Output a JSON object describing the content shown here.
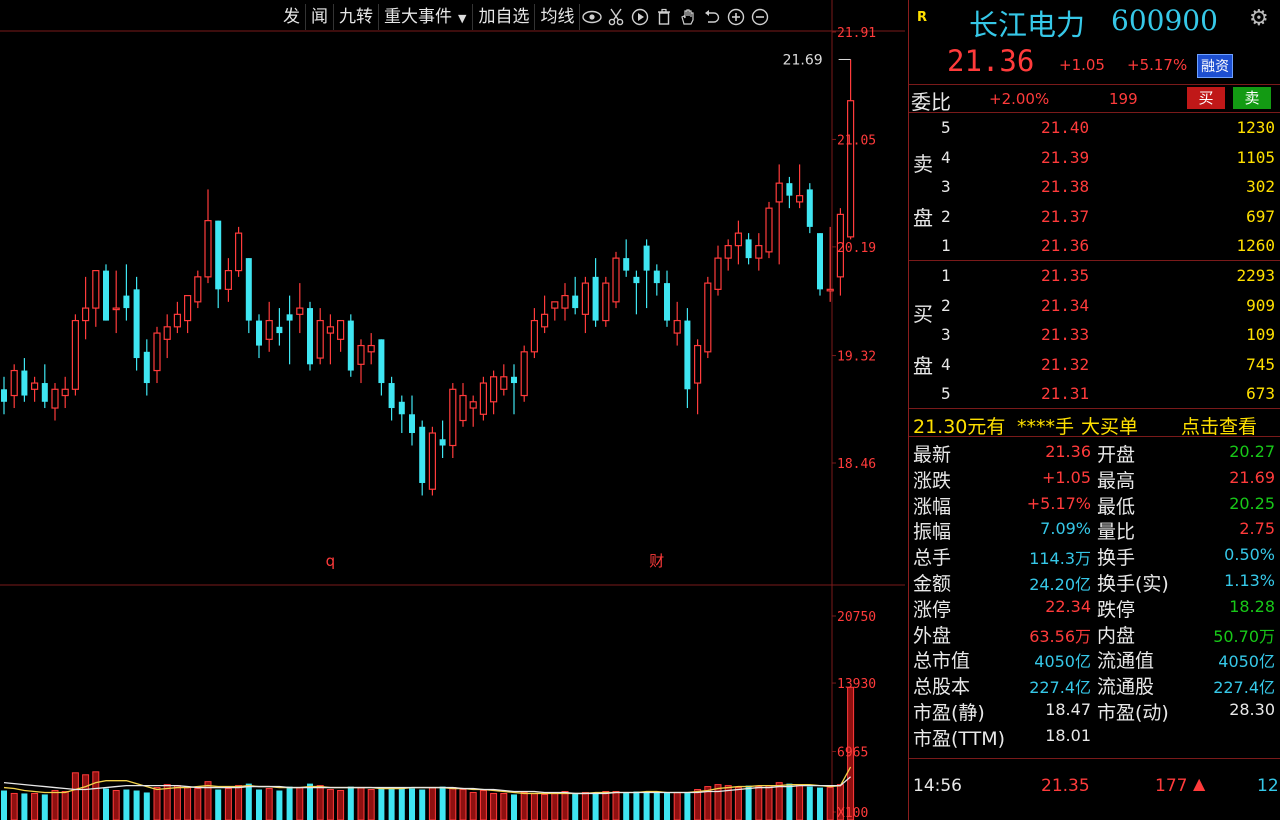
{
  "toolbar": {
    "buttons": [
      "发",
      "闻",
      "九转",
      "重大事件",
      "加自选",
      "均线"
    ],
    "icons": [
      "eye-icon",
      "scissors-icon",
      "play-icon",
      "trash-icon",
      "hand-icon",
      "undo-icon",
      "zoom-in-icon",
      "zoom-out-icon"
    ]
  },
  "main_chart": {
    "y_ticks": [
      "21.91",
      "21.05",
      "20.19",
      "19.32",
      "18.46"
    ],
    "high_marker": "21.69",
    "event_markers": [
      "q",
      "财"
    ]
  },
  "volume_chart": {
    "y_ticks": [
      "20750",
      "13930",
      "6965",
      "X100"
    ]
  },
  "colors": {
    "up": "#ff3b3b",
    "down": "#3fe6f2",
    "grid": "#7a1a1a",
    "ma_yellow": "#f2d24a",
    "ma_white": "#e8e8e8"
  },
  "stock": {
    "badge": "R",
    "name": "长江电力",
    "code": "600900",
    "price": "21.36",
    "change": "+1.05",
    "change_pct": "+5.17%",
    "tag": "融资"
  },
  "weibi": {
    "label": "委比",
    "pct": "+2.00%",
    "diff": "199",
    "buy_btn": "买",
    "sell_btn": "卖"
  },
  "order_book": {
    "sell_label": [
      "卖",
      "盘"
    ],
    "buy_label": [
      "买",
      "盘"
    ],
    "sells": [
      {
        "level": "5",
        "price": "21.40",
        "vol": "1230"
      },
      {
        "level": "4",
        "price": "21.39",
        "vol": "1105"
      },
      {
        "level": "3",
        "price": "21.38",
        "vol": "302"
      },
      {
        "level": "2",
        "price": "21.37",
        "vol": "697"
      },
      {
        "level": "1",
        "price": "21.36",
        "vol": "1260"
      }
    ],
    "buys": [
      {
        "level": "1",
        "price": "21.35",
        "vol": "2293"
      },
      {
        "level": "2",
        "price": "21.34",
        "vol": "909"
      },
      {
        "level": "3",
        "price": "21.33",
        "vol": "109"
      },
      {
        "level": "4",
        "price": "21.32",
        "vol": "745"
      },
      {
        "level": "5",
        "price": "21.31",
        "vol": "673"
      }
    ]
  },
  "big_order": {
    "price": "21.30元有",
    "stars": "****手",
    "text": "大买单",
    "link": "点击查看"
  },
  "stats": [
    {
      "l1": "最新",
      "v1": "21.36",
      "c1": "r",
      "l2": "开盘",
      "v2": "20.27",
      "c2": "g"
    },
    {
      "l1": "涨跌",
      "v1": "+1.05",
      "c1": "r",
      "l2": "最高",
      "v2": "21.69",
      "c2": "r"
    },
    {
      "l1": "涨幅",
      "v1": "+5.17%",
      "c1": "r",
      "l2": "最低",
      "v2": "20.25",
      "c2": "g"
    },
    {
      "l1": "振幅",
      "v1": "7.09%",
      "c1": "c",
      "l2": "量比",
      "v2": "2.75",
      "c2": "r"
    },
    {
      "l1": "总手",
      "v1": "114.3万",
      "c1": "c",
      "l2": "换手",
      "v2": "0.50%",
      "c2": "c"
    },
    {
      "l1": "金额",
      "v1": "24.20亿",
      "c1": "c",
      "l2": "换手(实)",
      "v2": "1.13%",
      "c2": "c"
    },
    {
      "l1": "涨停",
      "v1": "22.34",
      "c1": "r",
      "l2": "跌停",
      "v2": "18.28",
      "c2": "g"
    },
    {
      "l1": "外盘",
      "v1": "63.56万",
      "c1": "r",
      "l2": "内盘",
      "v2": "50.70万",
      "c2": "g"
    },
    {
      "l1": "总市值",
      "v1": "4050亿",
      "c1": "c",
      "l2": "流通值",
      "v2": "4050亿",
      "c2": "c"
    },
    {
      "l1": "总股本",
      "v1": "227.4亿",
      "c1": "c",
      "l2": "流通股",
      "v2": "227.4亿",
      "c2": "c"
    },
    {
      "l1": "市盈(静)",
      "v1": "18.47",
      "c1": "w",
      "l2": "市盈(动)",
      "v2": "28.30",
      "c2": "w"
    },
    {
      "l1": "市盈(TTM)",
      "v1": "18.01",
      "c1": "w",
      "l2": "",
      "v2": "",
      "c2": "w"
    }
  ],
  "tick": {
    "time": "14:56",
    "price": "21.35",
    "vol": "177",
    "count": "12"
  },
  "chart_data": [
    {
      "type": "candlestick",
      "y_ticks": [
        21.91,
        21.05,
        20.19,
        19.32,
        18.46
      ],
      "ylim": [
        18.0,
        22.0
      ],
      "candles": [
        {
          "o": 19.05,
          "h": 19.15,
          "l": 18.85,
          "c": 18.95
        },
        {
          "o": 19.0,
          "h": 19.25,
          "l": 18.9,
          "c": 19.2
        },
        {
          "o": 19.2,
          "h": 19.3,
          "l": 18.95,
          "c": 19.0
        },
        {
          "o": 19.05,
          "h": 19.15,
          "l": 18.95,
          "c": 19.1
        },
        {
          "o": 19.1,
          "h": 19.25,
          "l": 18.9,
          "c": 18.95
        },
        {
          "o": 18.9,
          "h": 19.1,
          "l": 18.8,
          "c": 19.05
        },
        {
          "o": 19.0,
          "h": 19.15,
          "l": 18.9,
          "c": 19.05
        },
        {
          "o": 19.05,
          "h": 19.65,
          "l": 19.0,
          "c": 19.6
        },
        {
          "o": 19.6,
          "h": 19.95,
          "l": 19.45,
          "c": 19.7
        },
        {
          "o": 19.7,
          "h": 20.0,
          "l": 19.55,
          "c": 20.0
        },
        {
          "o": 20.0,
          "h": 20.05,
          "l": 19.6,
          "c": 19.6
        },
        {
          "o": 19.7,
          "h": 20.0,
          "l": 19.5,
          "c": 19.7
        },
        {
          "o": 19.8,
          "h": 20.05,
          "l": 19.6,
          "c": 19.7
        },
        {
          "o": 19.85,
          "h": 19.95,
          "l": 19.2,
          "c": 19.3
        },
        {
          "o": 19.35,
          "h": 19.45,
          "l": 19.0,
          "c": 19.1
        },
        {
          "o": 19.2,
          "h": 19.55,
          "l": 19.1,
          "c": 19.5
        },
        {
          "o": 19.45,
          "h": 19.65,
          "l": 19.3,
          "c": 19.55
        },
        {
          "o": 19.55,
          "h": 19.75,
          "l": 19.5,
          "c": 19.65
        },
        {
          "o": 19.6,
          "h": 19.8,
          "l": 19.5,
          "c": 19.8
        },
        {
          "o": 19.75,
          "h": 20.0,
          "l": 19.7,
          "c": 19.95
        },
        {
          "o": 19.95,
          "h": 20.65,
          "l": 19.9,
          "c": 20.4
        },
        {
          "o": 20.4,
          "h": 20.4,
          "l": 19.7,
          "c": 19.85
        },
        {
          "o": 19.85,
          "h": 20.1,
          "l": 19.75,
          "c": 20.0
        },
        {
          "o": 20.0,
          "h": 20.35,
          "l": 19.95,
          "c": 20.3
        },
        {
          "o": 20.1,
          "h": 20.1,
          "l": 19.5,
          "c": 19.6
        },
        {
          "o": 19.6,
          "h": 19.65,
          "l": 19.3,
          "c": 19.4
        },
        {
          "o": 19.45,
          "h": 19.75,
          "l": 19.35,
          "c": 19.6
        },
        {
          "o": 19.55,
          "h": 19.7,
          "l": 19.4,
          "c": 19.5
        },
        {
          "o": 19.65,
          "h": 19.8,
          "l": 19.25,
          "c": 19.6
        },
        {
          "o": 19.65,
          "h": 19.9,
          "l": 19.5,
          "c": 19.7
        },
        {
          "o": 19.7,
          "h": 19.75,
          "l": 19.2,
          "c": 19.25
        },
        {
          "o": 19.3,
          "h": 19.7,
          "l": 19.25,
          "c": 19.6
        },
        {
          "o": 19.5,
          "h": 19.65,
          "l": 19.25,
          "c": 19.55
        },
        {
          "o": 19.45,
          "h": 19.6,
          "l": 19.35,
          "c": 19.6
        },
        {
          "o": 19.6,
          "h": 19.65,
          "l": 19.15,
          "c": 19.2
        },
        {
          "o": 19.25,
          "h": 19.45,
          "l": 19.1,
          "c": 19.4
        },
        {
          "o": 19.35,
          "h": 19.5,
          "l": 19.25,
          "c": 19.4
        },
        {
          "o": 19.45,
          "h": 19.45,
          "l": 19.0,
          "c": 19.1
        },
        {
          "o": 19.1,
          "h": 19.15,
          "l": 18.8,
          "c": 18.9
        },
        {
          "o": 18.95,
          "h": 19.0,
          "l": 18.7,
          "c": 18.85
        },
        {
          "o": 18.85,
          "h": 19.0,
          "l": 18.6,
          "c": 18.7
        },
        {
          "o": 18.75,
          "h": 18.8,
          "l": 18.2,
          "c": 18.3
        },
        {
          "o": 18.25,
          "h": 18.75,
          "l": 18.2,
          "c": 18.7
        },
        {
          "o": 18.65,
          "h": 18.8,
          "l": 18.5,
          "c": 18.6
        },
        {
          "o": 18.6,
          "h": 19.1,
          "l": 18.5,
          "c": 19.05
        },
        {
          "o": 18.8,
          "h": 19.1,
          "l": 18.75,
          "c": 19.0
        },
        {
          "o": 18.9,
          "h": 19.0,
          "l": 18.75,
          "c": 18.95
        },
        {
          "o": 18.85,
          "h": 19.15,
          "l": 18.8,
          "c": 19.1
        },
        {
          "o": 18.95,
          "h": 19.2,
          "l": 18.85,
          "c": 19.15
        },
        {
          "o": 19.05,
          "h": 19.25,
          "l": 19.0,
          "c": 19.15
        },
        {
          "o": 19.15,
          "h": 19.25,
          "l": 18.85,
          "c": 19.1
        },
        {
          "o": 19.0,
          "h": 19.4,
          "l": 18.95,
          "c": 19.35
        },
        {
          "o": 19.35,
          "h": 19.7,
          "l": 19.3,
          "c": 19.6
        },
        {
          "o": 19.55,
          "h": 19.8,
          "l": 19.5,
          "c": 19.65
        },
        {
          "o": 19.7,
          "h": 19.75,
          "l": 19.6,
          "c": 19.75
        },
        {
          "o": 19.7,
          "h": 19.9,
          "l": 19.6,
          "c": 19.8
        },
        {
          "o": 19.8,
          "h": 19.95,
          "l": 19.65,
          "c": 19.7
        },
        {
          "o": 19.65,
          "h": 19.95,
          "l": 19.5,
          "c": 19.9
        },
        {
          "o": 19.95,
          "h": 20.1,
          "l": 19.55,
          "c": 19.6
        },
        {
          "o": 19.6,
          "h": 19.95,
          "l": 19.55,
          "c": 19.9
        },
        {
          "o": 19.75,
          "h": 20.15,
          "l": 19.7,
          "c": 20.1
        },
        {
          "o": 20.1,
          "h": 20.25,
          "l": 19.95,
          "c": 20.0
        },
        {
          "o": 19.95,
          "h": 20.0,
          "l": 19.65,
          "c": 19.9
        },
        {
          "o": 20.2,
          "h": 20.25,
          "l": 19.7,
          "c": 20.0
        },
        {
          "o": 20.0,
          "h": 20.05,
          "l": 19.8,
          "c": 19.9
        },
        {
          "o": 19.9,
          "h": 20.0,
          "l": 19.55,
          "c": 19.6
        },
        {
          "o": 19.5,
          "h": 19.75,
          "l": 19.4,
          "c": 19.6
        },
        {
          "o": 19.6,
          "h": 19.7,
          "l": 18.9,
          "c": 19.05
        },
        {
          "o": 19.1,
          "h": 19.45,
          "l": 18.85,
          "c": 19.4
        },
        {
          "o": 19.35,
          "h": 19.95,
          "l": 19.3,
          "c": 19.9
        },
        {
          "o": 19.85,
          "h": 20.2,
          "l": 19.8,
          "c": 20.1
        },
        {
          "o": 20.1,
          "h": 20.25,
          "l": 20.0,
          "c": 20.2
        },
        {
          "o": 20.2,
          "h": 20.4,
          "l": 20.05,
          "c": 20.3
        },
        {
          "o": 20.25,
          "h": 20.3,
          "l": 20.05,
          "c": 20.1
        },
        {
          "o": 20.1,
          "h": 20.3,
          "l": 20.0,
          "c": 20.2
        },
        {
          "o": 20.15,
          "h": 20.55,
          "l": 20.1,
          "c": 20.5
        },
        {
          "o": 20.55,
          "h": 20.85,
          "l": 20.05,
          "c": 20.7
        },
        {
          "o": 20.7,
          "h": 20.75,
          "l": 20.5,
          "c": 20.6
        },
        {
          "o": 20.55,
          "h": 20.85,
          "l": 20.5,
          "c": 20.6
        },
        {
          "o": 20.65,
          "h": 20.7,
          "l": 20.3,
          "c": 20.35
        },
        {
          "o": 20.3,
          "h": 20.3,
          "l": 19.8,
          "c": 19.85
        },
        {
          "o": 19.85,
          "h": 20.35,
          "l": 19.75,
          "c": 19.85
        },
        {
          "o": 19.95,
          "h": 20.5,
          "l": 19.8,
          "c": 20.45
        },
        {
          "o": 20.27,
          "h": 21.69,
          "l": 20.25,
          "c": 21.36
        }
      ]
    },
    {
      "type": "bar",
      "y_ticks": [
        20750,
        13930,
        6965
      ],
      "ylim": [
        0,
        24000
      ],
      "values": [
        3000,
        2700,
        2700,
        2700,
        2600,
        3000,
        2900,
        4800,
        4600,
        4900,
        3200,
        3000,
        3100,
        3000,
        2800,
        3300,
        3600,
        3500,
        3300,
        3200,
        3900,
        3100,
        3200,
        3500,
        3700,
        3100,
        3200,
        3000,
        3400,
        3300,
        3700,
        3500,
        3100,
        3000,
        3400,
        3300,
        3100,
        3300,
        3200,
        3300,
        3200,
        3100,
        3300,
        3400,
        3300,
        3100,
        2800,
        3000,
        2700,
        2700,
        2600,
        2800,
        2700,
        2600,
        2700,
        2900,
        2700,
        2800,
        2800,
        2900,
        2900,
        2800,
        2900,
        2900,
        2800,
        2800,
        2800,
        2800,
        3100,
        3400,
        3600,
        3500,
        3300,
        3500,
        3400,
        3500,
        3800,
        3700,
        3600,
        3400,
        3300,
        3300,
        3600,
        13500
      ],
      "ma": [
        {
          "name": "MA5",
          "color": "yellow",
          "values": [
            3300,
            3200,
            3000,
            2900,
            2800,
            2800,
            2800,
            3100,
            3400,
            3800,
            4000,
            4000,
            4000,
            3700,
            3400,
            3100,
            3200,
            3300,
            3300,
            3400,
            3500,
            3400,
            3400,
            3400,
            3500,
            3400,
            3400,
            3300,
            3300,
            3300,
            3400,
            3400,
            3300,
            3300,
            3300,
            3300,
            3300,
            3200,
            3200,
            3200,
            3300,
            3300,
            3300,
            3300,
            3200,
            3200,
            3100,
            3100,
            3000,
            2900,
            2800,
            2700,
            2700,
            2700,
            2700,
            2700,
            2700,
            2700,
            2800,
            2800,
            2800,
            2800,
            2800,
            2900,
            2900,
            2800,
            2800,
            2800,
            2900,
            3000,
            3200,
            3300,
            3400,
            3400,
            3500,
            3500,
            3500,
            3600,
            3600,
            3600,
            3500,
            3400,
            3500,
            5400
          ]
        },
        {
          "name": "MA10",
          "color": "white",
          "values": [
            3800,
            3700,
            3600,
            3500,
            3400,
            3300,
            3200,
            3100,
            3100,
            3200,
            3300,
            3400,
            3500,
            3500,
            3500,
            3500,
            3500,
            3500,
            3400,
            3300,
            3300,
            3300,
            3300,
            3300,
            3400,
            3400,
            3400,
            3400,
            3300,
            3300,
            3300,
            3300,
            3300,
            3300,
            3300,
            3300,
            3300,
            3300,
            3300,
            3300,
            3300,
            3300,
            3300,
            3300,
            3300,
            3200,
            3200,
            3100,
            3100,
            3000,
            2900,
            2900,
            2900,
            2800,
            2800,
            2800,
            2700,
            2700,
            2700,
            2700,
            2800,
            2800,
            2800,
            2800,
            2800,
            2800,
            2800,
            2800,
            2800,
            2900,
            2900,
            3000,
            3100,
            3200,
            3300,
            3300,
            3400,
            3400,
            3500,
            3500,
            3500,
            3500,
            3500,
            4400
          ]
        }
      ]
    }
  ]
}
